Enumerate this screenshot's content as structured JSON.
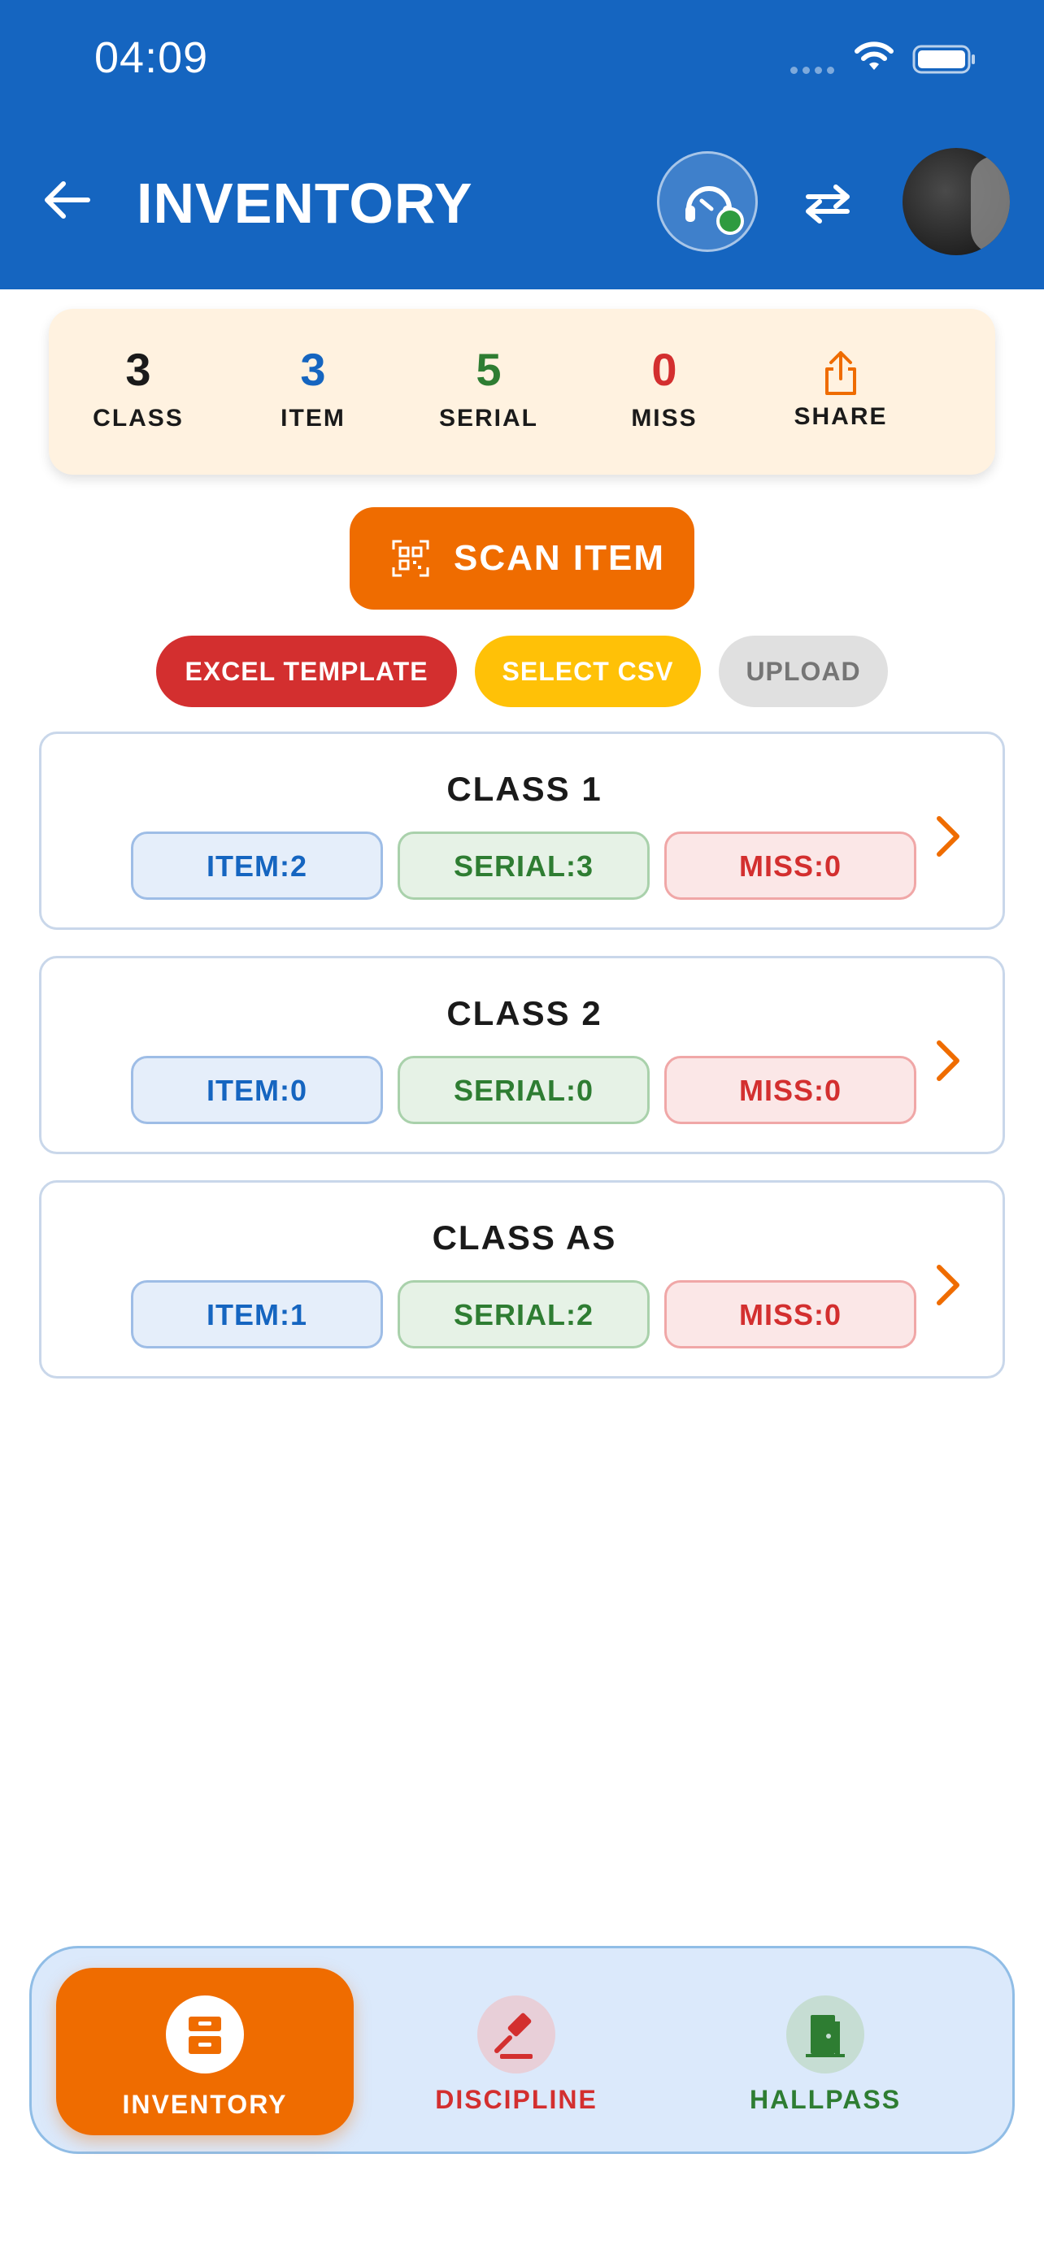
{
  "status_bar": {
    "time": "04:09"
  },
  "header": {
    "title": "INVENTORY"
  },
  "summary": {
    "stats": [
      {
        "value": "3",
        "label": "CLASS",
        "color": "#1a1a1a"
      },
      {
        "value": "3",
        "label": "ITEM",
        "color": "#1565c0"
      },
      {
        "value": "5",
        "label": "SERIAL",
        "color": "#2e7d32"
      },
      {
        "value": "0",
        "label": "MISS",
        "color": "#d32f2f"
      }
    ],
    "share_label": "SHARE"
  },
  "actions": {
    "scan_label": "SCAN ITEM",
    "excel_label": "EXCEL TEMPLATE",
    "csv_label": "SELECT CSV",
    "upload_label": "UPLOAD"
  },
  "classes": [
    {
      "name": "CLASS 1",
      "item": "ITEM:2",
      "serial": "SERIAL:3",
      "miss": "MISS:0"
    },
    {
      "name": "CLASS 2",
      "item": "ITEM:0",
      "serial": "SERIAL:0",
      "miss": "MISS:0"
    },
    {
      "name": "CLASS AS",
      "item": "ITEM:1",
      "serial": "SERIAL:2",
      "miss": "MISS:0"
    }
  ],
  "bottom_nav": {
    "items": [
      {
        "label": "INVENTORY",
        "icon": "inbox-tray-icon",
        "active": true,
        "color": "#ffffff"
      },
      {
        "label": "DISCIPLINE",
        "icon": "gavel-icon",
        "active": false,
        "color": "#d32f2f"
      },
      {
        "label": "HALLPASS",
        "icon": "door-exit-icon",
        "active": false,
        "color": "#2e7d32"
      }
    ]
  },
  "colors": {
    "brand_blue": "#1565c0",
    "accent_orange": "#ef6c00"
  }
}
